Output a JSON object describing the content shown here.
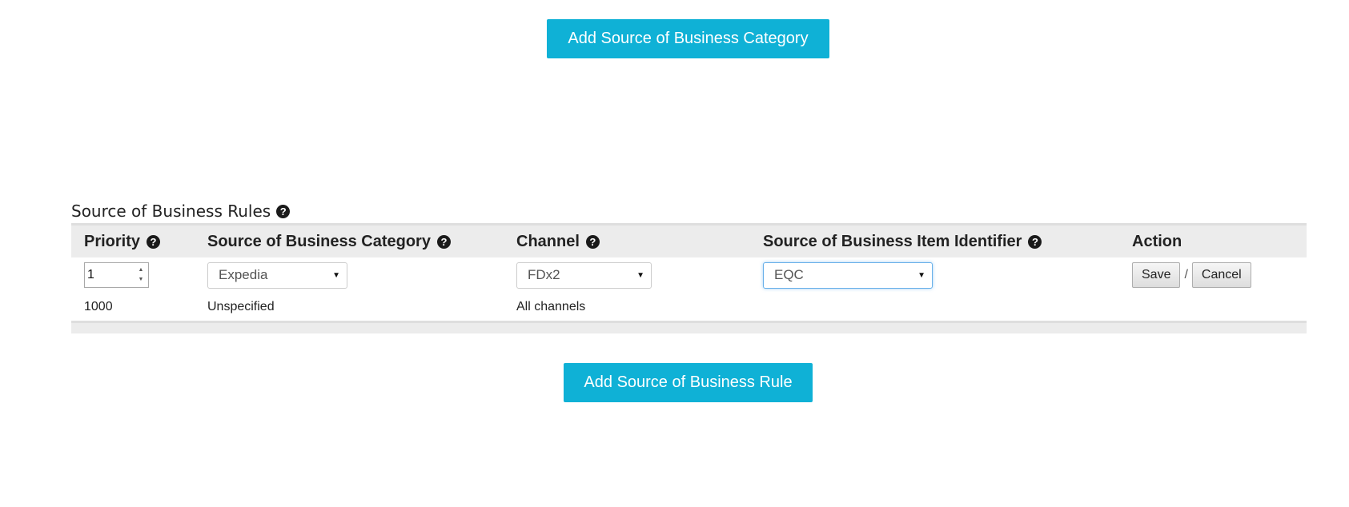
{
  "buttons": {
    "add_category": "Add Source of Business Category",
    "add_rule": "Add Source of Business Rule"
  },
  "section": {
    "title": "Source of Business Rules"
  },
  "help_icon_glyph": "?",
  "table": {
    "headers": {
      "priority": "Priority",
      "category": "Source of Business Category",
      "channel": "Channel",
      "item_identifier": "Source of Business Item Identifier",
      "action": "Action"
    },
    "edit_row": {
      "priority_value": "1",
      "category_selected": "Expedia",
      "channel_selected": "FDx2",
      "item_identifier_selected": "EQC",
      "save_label": "Save",
      "separator": "/",
      "cancel_label": "Cancel"
    },
    "rows": [
      {
        "priority": "1000",
        "category": "Unspecified",
        "channel": "All channels",
        "item_identifier": ""
      }
    ]
  },
  "colors": {
    "accent": "#0fb1d6",
    "header_bg": "#ececec",
    "focus_border": "#66afe9"
  },
  "icons": {
    "help": "question-circle-icon",
    "select_caret": "caret-down-icon",
    "spinner": "spinner-arrows-icon"
  }
}
